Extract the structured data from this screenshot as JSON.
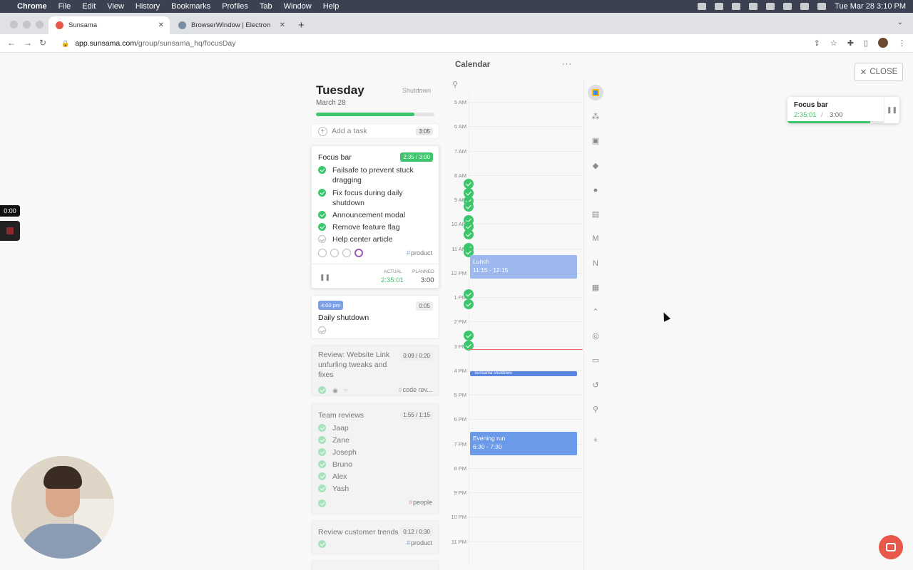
{
  "menubar": {
    "app": "Chrome",
    "items": [
      "File",
      "Edit",
      "View",
      "History",
      "Bookmarks",
      "Profiles",
      "Tab",
      "Window",
      "Help"
    ],
    "clock": "Tue Mar 28  3:10 PM"
  },
  "browser": {
    "tabs": [
      {
        "title": "Sunsama",
        "favicon_color": "#e8584a"
      },
      {
        "title": "BrowserWindow | Electron",
        "favicon_color": "#7a8ca6"
      }
    ],
    "url_host": "app.sunsama.com",
    "url_path": "/group/sunsama_hq/focusDay"
  },
  "recording": {
    "time": "0:00"
  },
  "day": {
    "title": "Tuesday",
    "date": "March 28",
    "shutdown_label": "Shutdown",
    "progress_fraction": 0.83,
    "add_task": {
      "label": "Add a task",
      "time": "3:05"
    }
  },
  "focus_task": {
    "title": "Focus bar",
    "badge": "2:35 / 3:00",
    "subtasks": [
      {
        "text": "Failsafe to prevent stuck dragging",
        "done": true
      },
      {
        "text": "Fix focus during daily shutdown",
        "done": true
      },
      {
        "text": "Announcement modal",
        "done": true
      },
      {
        "text": "Remove feature flag",
        "done": true
      },
      {
        "text": "Help center article",
        "done": false
      }
    ],
    "tag": "product",
    "actual_label": "ACTUAL",
    "actual_value": "2:35:01",
    "planned_label": "PLANNED",
    "planned_value": "3:00"
  },
  "shutdown_task": {
    "time_pill": "4:00 pm",
    "title": "Daily shutdown",
    "badge": "0:05"
  },
  "review_task": {
    "title": "Review: Website Link unfurling tweaks and fixes",
    "badge": "0:09 / 0:20",
    "tag": "code rev..."
  },
  "team_task": {
    "title": "Team reviews",
    "badge": "1:55 / 1:15",
    "people": [
      "Jaap",
      "Zane",
      "Joseph",
      "Bruno",
      "Alex",
      "Yash"
    ],
    "tag": "people"
  },
  "trends_task": {
    "title": "Review customer trends",
    "badge": "0:12 / 0:30",
    "tag": "product"
  },
  "calendar": {
    "title": "Calendar",
    "menu": "···",
    "hours": [
      "5 AM",
      "6 AM",
      "7 AM",
      "8 AM",
      "9 AM",
      "10 AM",
      "11 AM",
      "12 PM",
      "1 PM",
      "2 PM",
      "3 PM",
      "4 PM",
      "5 PM",
      "6 PM",
      "7 PM",
      "8 PM",
      "9 PM",
      "10 PM",
      "11 PM"
    ],
    "events": {
      "lunch": {
        "name": "Lunch",
        "time": "11:15 - 12:15"
      },
      "shutdown": {
        "name": "Sunsama shutdown"
      },
      "run": {
        "name": "Evening run",
        "time": "6:30 - 7:30"
      }
    }
  },
  "close_label": "CLOSE",
  "focusbar": {
    "title": "Focus bar",
    "actual": "2:35:01",
    "sep": "/",
    "planned": "3:00",
    "progress_fraction": 0.86
  },
  "colors": {
    "accent_green": "#3cc56b",
    "event_blue": "#6a9ae8",
    "now_line": "#e8776a",
    "chat": "#e8584a"
  }
}
